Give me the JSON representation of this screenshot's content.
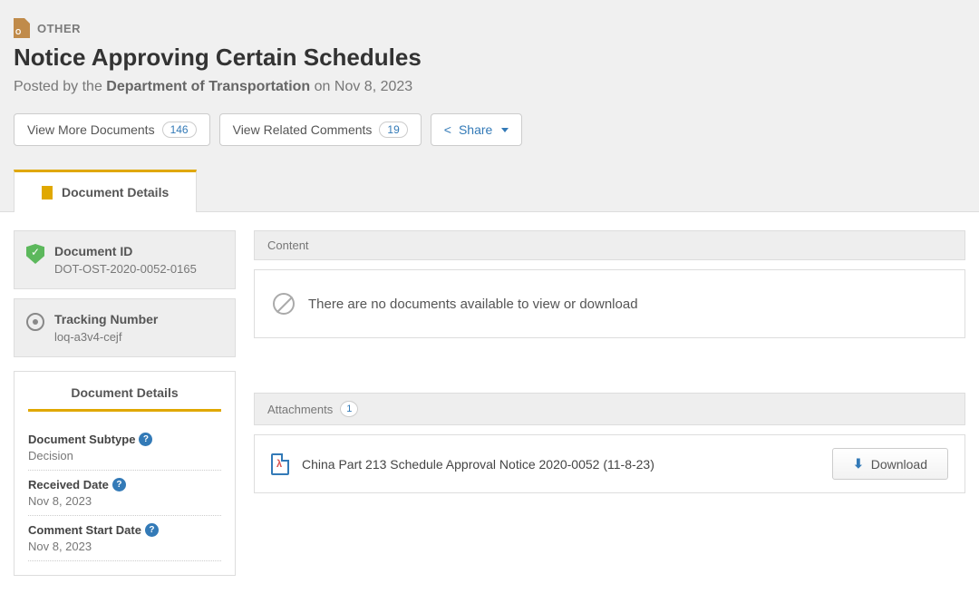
{
  "header": {
    "doc_type_label": "OTHER",
    "title": "Notice Approving Certain Schedules",
    "posted_prefix": "Posted by the ",
    "agency": "Department of Transportation",
    "posted_suffix": " on Nov 8, 2023",
    "buttons": {
      "view_more": "View More Documents",
      "view_more_count": "146",
      "view_related": "View Related Comments",
      "view_related_count": "19",
      "share": "Share"
    }
  },
  "tabs": {
    "details": "Document Details"
  },
  "sidebar": {
    "doc_id_label": "Document ID",
    "doc_id": "DOT-OST-2020-0052-0165",
    "tracking_label": "Tracking Number",
    "tracking": "loq-a3v4-cejf",
    "panel_header": "Document Details",
    "subtype_label": "Document Subtype",
    "subtype_value": "Decision",
    "received_label": "Received Date",
    "received_value": "Nov 8, 2023",
    "comment_start_label": "Comment Start Date",
    "comment_start_value": "Nov 8, 2023"
  },
  "main": {
    "content_header": "Content",
    "no_docs": "There are no documents available to view or download",
    "attachments_header": "Attachments",
    "attachments_count": "1",
    "attachment_title": "China Part 213 Schedule Approval Notice 2020-0052 (11-8-23)",
    "download_label": "Download"
  }
}
